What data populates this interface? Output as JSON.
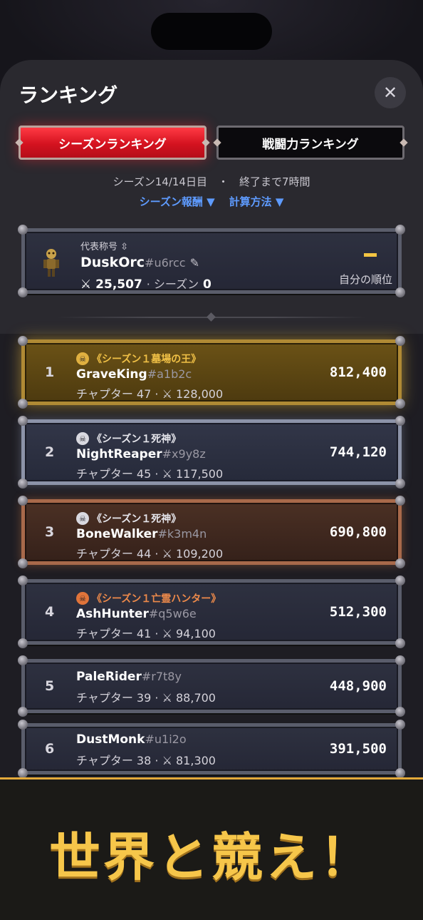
{
  "header": {
    "title": "ランキング",
    "close_label": "✕"
  },
  "tabs": [
    {
      "label": "シーズンランキング",
      "active": true
    },
    {
      "label": "戦闘力ランキング",
      "active": false
    }
  ],
  "season_info": "シーズン14/14日目　・　終了まで7時間",
  "links": {
    "reward": "シーズン報酬 ▼",
    "method": "計算方法 ▼"
  },
  "me": {
    "title_label": "代表称号 ⇳",
    "name": "DuskOrc",
    "tag": "#u6rcc",
    "power": "25,507",
    "season_label": "· シーズン",
    "season_value": "0",
    "rank_label": "自分の順位"
  },
  "rankings": [
    {
      "rank": "1",
      "title": "《シーズン１墓場の王》",
      "name": "GraveKing",
      "tag": "#a1b2c",
      "chapter": "チャプター 47 ·",
      "power": "128,000",
      "score": "812,400",
      "title_color": "#f0c046"
    },
    {
      "rank": "2",
      "title": "《シーズン１死神》",
      "name": "NightReaper",
      "tag": "#x9y8z",
      "chapter": "チャプター 45 ·",
      "power": "117,500",
      "score": "744,120",
      "title_color": "#e6e6ec"
    },
    {
      "rank": "3",
      "title": "《シーズン１死神》",
      "name": "BoneWalker",
      "tag": "#k3m4n",
      "chapter": "チャプター 44 ·",
      "power": "109,200",
      "score": "690,800",
      "title_color": "#e6e6ec"
    },
    {
      "rank": "4",
      "title": "《シーズン１亡霊ハンター》",
      "name": "AshHunter",
      "tag": "#q5w6e",
      "chapter": "チャプター 41 ·",
      "power": "94,100",
      "score": "512,300",
      "title_color": "#ee8a4a"
    },
    {
      "rank": "5",
      "title": "",
      "name": "PaleRider",
      "tag": "#r7t8y",
      "chapter": "チャプター 39 ·",
      "power": "88,700",
      "score": "448,900",
      "title_color": ""
    },
    {
      "rank": "6",
      "title": "",
      "name": "DustMonk",
      "tag": "#u1i2o",
      "chapter": "チャプター 38 ·",
      "power": "81,300",
      "score": "391,500",
      "title_color": ""
    }
  ],
  "footer": {
    "text": "世界と競え！"
  }
}
